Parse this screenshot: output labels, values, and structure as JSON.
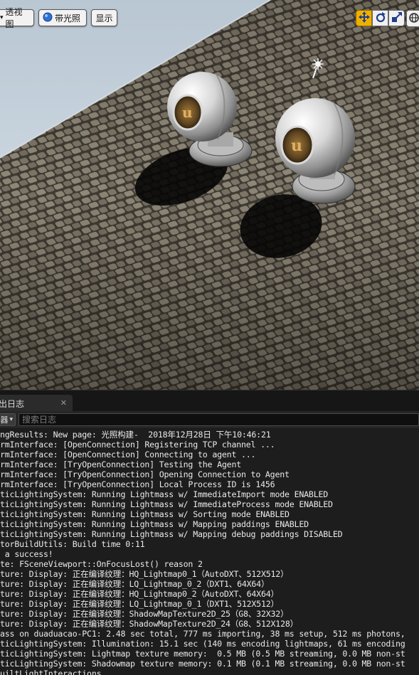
{
  "viewport": {
    "buttons": {
      "perspective": "透视图",
      "lit": "带光照",
      "show": "显示"
    },
    "transform_tools": [
      {
        "icon": "move-icon",
        "active": true
      },
      {
        "icon": "rotate-icon",
        "active": false
      },
      {
        "icon": "scale-icon",
        "active": false
      }
    ],
    "extra_tool_icon": "world-local-icon",
    "scene_icons": [
      "light-source-icon"
    ],
    "colors": {
      "active_tool": "#f0b000",
      "sky": "#c8d4de"
    }
  },
  "output_log": {
    "tab_label": "出日志",
    "filter_label": "器",
    "search_placeholder": "搜索日志",
    "lines": [
      "ngResults: New page: 光照构建-  2018年12月28日 下午10:46:21",
      "rmInterface: [OpenConnection] Registering TCP channel ...",
      "rmInterface: [OpenConnection] Connecting to agent ...",
      "rmInterface: [TryOpenConnection] Testing the Agent",
      "rmInterface: [TryOpenConnection] Opening Connection to Agent",
      "rmInterface: [TryOpenConnection] Local Process ID is 1456",
      "ticLightingSystem: Running Lightmass w/ ImmediateImport mode ENABLED",
      "ticLightingSystem: Running Lightmass w/ ImmediateProcess mode ENABLED",
      "ticLightingSystem: Running Lightmass w/ Sorting mode ENABLED",
      "ticLightingSystem: Running Lightmass w/ Mapping paddings ENABLED",
      "ticLightingSystem: Running Lightmass w/ Mapping debug paddings DISABLED",
      "torBuildUtils: Build time 0:11",
      " a success!",
      "te: FSceneViewport::OnFocusLost() reason 2",
      "ture: Display: 正在编译纹理：HQ_Lightmap0_1（AutoDXT、512X512）",
      "ture: Display: 正在编译纹理：LQ_Lightmap_0_2（DXT1、64X64）",
      "ture: Display: 正在编译纹理：HQ_Lightmap0_2（AutoDXT、64X64）",
      "ture: Display: 正在编译纹理：LQ_Lightmap_0_1（DXT1、512X512）",
      "ture: Display: 正在编译纹理：ShadowMapTexture2D_25（G8、32X32）",
      "ture: Display: 正在编译纹理：ShadowMapTexture2D_24（G8、512X128）",
      "ass on duaduacao-PC1: 2.48 sec total, 777 ms importing, 38 ms setup, 512 ms photons,",
      "ticLightingSystem: Illumination: 15.1 sec (140 ms encoding lightmaps, 61 ms encoding",
      "ticLightingSystem: Lightmap texture memory:  0.5 MB (0.5 MB streaming, 0.0 MB non-st",
      "ticLightingSystem: Shadowmap texture memory: 0.1 MB (0.1 MB streaming, 0.0 MB non-st",
      "uiltLightInteractions"
    ],
    "colors": {
      "background": "#1d1d1d",
      "text": "#e9e9e9"
    }
  }
}
